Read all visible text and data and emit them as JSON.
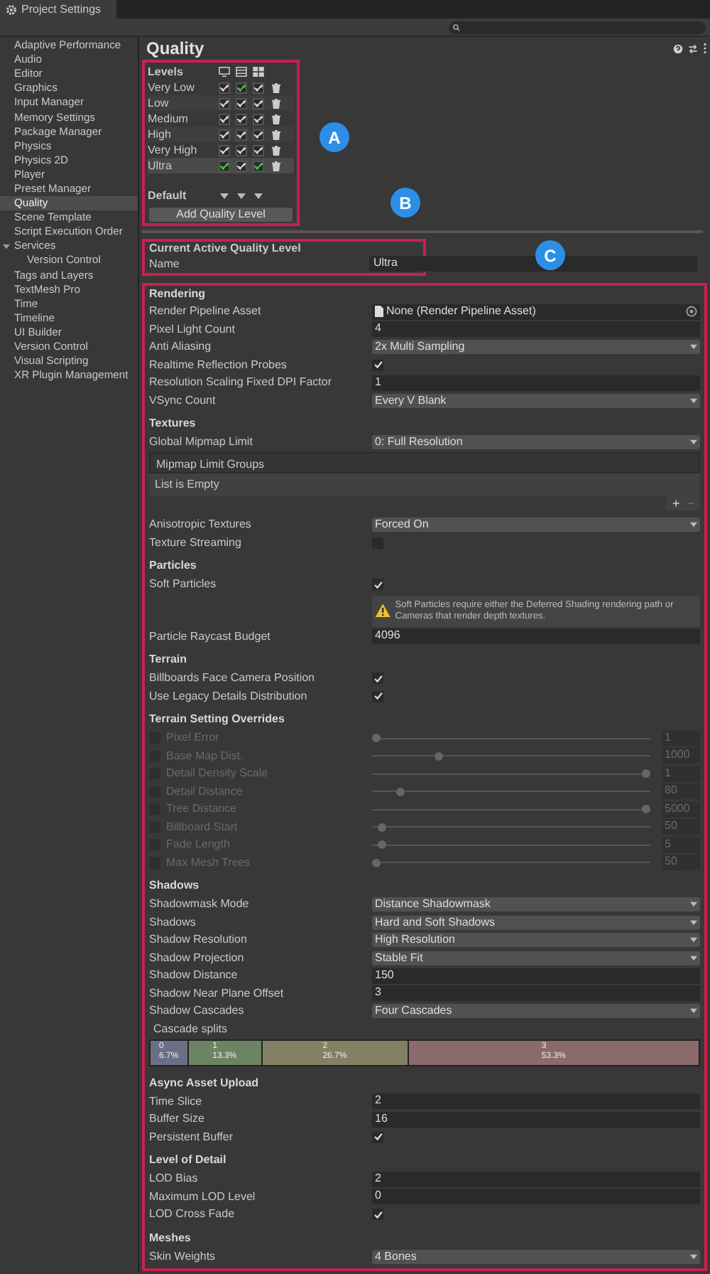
{
  "window": {
    "title": "Project Settings"
  },
  "sidebar": {
    "items": [
      {
        "label": "Adaptive Performance",
        "selected": false
      },
      {
        "label": "Audio",
        "selected": false
      },
      {
        "label": "Editor",
        "selected": false
      },
      {
        "label": "Graphics",
        "selected": false
      },
      {
        "label": "Input Manager",
        "selected": false
      },
      {
        "label": "Memory Settings",
        "selected": false
      },
      {
        "label": "Package Manager",
        "selected": false
      },
      {
        "label": "Physics",
        "selected": false
      },
      {
        "label": "Physics 2D",
        "selected": false
      },
      {
        "label": "Player",
        "selected": false
      },
      {
        "label": "Preset Manager",
        "selected": false
      },
      {
        "label": "Quality",
        "selected": true
      },
      {
        "label": "Scene Template",
        "selected": false
      },
      {
        "label": "Script Execution Order",
        "selected": false
      },
      {
        "label": "Services",
        "selected": false,
        "expanded": true,
        "children": [
          {
            "label": "Version Control",
            "selected": false
          }
        ]
      },
      {
        "label": "Tags and Layers",
        "selected": false
      },
      {
        "label": "TextMesh Pro",
        "selected": false
      },
      {
        "label": "Time",
        "selected": false
      },
      {
        "label": "Timeline",
        "selected": false
      },
      {
        "label": "UI Builder",
        "selected": false
      },
      {
        "label": "Version Control",
        "selected": false
      },
      {
        "label": "Visual Scripting",
        "selected": false
      },
      {
        "label": "XR Plugin Management",
        "selected": false
      }
    ]
  },
  "page_title": "Quality",
  "levels": {
    "title": "Levels",
    "rows": [
      {
        "name": "Very Low",
        "selected": false,
        "platforms": [
          {
            "checked": true,
            "color": "#c8c8c8"
          },
          {
            "checked": true,
            "color": "#3fbf3f"
          },
          {
            "checked": true,
            "color": "#c8c8c8"
          }
        ]
      },
      {
        "name": "Low",
        "selected": false,
        "platforms": [
          {
            "checked": true,
            "color": "#c8c8c8"
          },
          {
            "checked": true,
            "color": "#c8c8c8"
          },
          {
            "checked": true,
            "color": "#c8c8c8"
          }
        ]
      },
      {
        "name": "Medium",
        "selected": false,
        "platforms": [
          {
            "checked": true,
            "color": "#c8c8c8"
          },
          {
            "checked": true,
            "color": "#c8c8c8"
          },
          {
            "checked": true,
            "color": "#c8c8c8"
          }
        ]
      },
      {
        "name": "High",
        "selected": false,
        "platforms": [
          {
            "checked": true,
            "color": "#c8c8c8"
          },
          {
            "checked": true,
            "color": "#c8c8c8"
          },
          {
            "checked": true,
            "color": "#c8c8c8"
          }
        ]
      },
      {
        "name": "Very High",
        "selected": false,
        "platforms": [
          {
            "checked": true,
            "color": "#c8c8c8"
          },
          {
            "checked": true,
            "color": "#c8c8c8"
          },
          {
            "checked": true,
            "color": "#c8c8c8"
          }
        ]
      },
      {
        "name": "Ultra",
        "selected": true,
        "platforms": [
          {
            "checked": true,
            "color": "#3fbf3f"
          },
          {
            "checked": true,
            "color": "#c8c8c8"
          },
          {
            "checked": true,
            "color": "#3fbf3f"
          }
        ]
      }
    ],
    "default_label": "Default",
    "add_button": "Add Quality Level"
  },
  "callouts": [
    {
      "label": "A"
    },
    {
      "label": "B"
    },
    {
      "label": "C"
    }
  ],
  "current_level": {
    "title": "Current Active Quality Level",
    "name_label": "Name",
    "name_value": "Ultra"
  },
  "sections": [
    {
      "title": "Rendering",
      "rows": [
        {
          "kind": "asset",
          "label": "Render Pipeline Asset",
          "value": "None (Render Pipeline Asset)"
        },
        {
          "kind": "number",
          "label": "Pixel Light Count",
          "value": "4"
        },
        {
          "kind": "dropdown",
          "label": "Anti Aliasing",
          "value": "2x Multi Sampling"
        },
        {
          "kind": "toggle",
          "label": "Realtime Reflection Probes",
          "checked": true
        },
        {
          "kind": "number",
          "label": "Resolution Scaling Fixed DPI Factor",
          "value": "1"
        },
        {
          "kind": "dropdown",
          "label": "VSync Count",
          "value": "Every V Blank"
        }
      ]
    },
    {
      "title": "Textures",
      "rows": [
        {
          "kind": "dropdown",
          "label": "Global Mipmap Limit",
          "value": "0: Full Resolution"
        },
        {
          "kind": "list",
          "label": "Mipmap Limit Groups",
          "value": "List is Empty",
          "add": "+",
          "remove": "−"
        },
        {
          "kind": "dropdown",
          "label": "Anisotropic Textures",
          "value": "Forced On"
        },
        {
          "kind": "toggle",
          "label": "Texture Streaming",
          "checked": false
        }
      ]
    },
    {
      "title": "Particles",
      "rows": [
        {
          "kind": "toggle",
          "label": "Soft Particles",
          "checked": true
        },
        {
          "kind": "warning",
          "value": "Soft Particles require either the Deferred Shading rendering path or Cameras that render depth textures."
        },
        {
          "kind": "number",
          "label": "Particle Raycast Budget",
          "value": "4096"
        }
      ]
    },
    {
      "title": "Terrain",
      "rows": [
        {
          "kind": "toggle",
          "label": "Billboards Face Camera Position",
          "checked": true
        },
        {
          "kind": "toggle",
          "label": "Use Legacy Details Distribution",
          "checked": true
        }
      ]
    },
    {
      "title": "Terrain Setting Overrides",
      "rows": [
        {
          "kind": "slider",
          "label": "Pixel Error",
          "override": false,
          "level": 0,
          "value": "1"
        },
        {
          "kind": "slider",
          "label": "Base Map Dist.",
          "override": false,
          "level": 0.23,
          "value": "1000"
        },
        {
          "kind": "slider",
          "label": "Detail Density Scale",
          "override": false,
          "level": 1,
          "value": "1"
        },
        {
          "kind": "slider",
          "label": "Detail Distance",
          "override": false,
          "level": 0.09,
          "value": "80"
        },
        {
          "kind": "slider",
          "label": "Tree Distance",
          "override": false,
          "level": 1,
          "value": "5000"
        },
        {
          "kind": "slider",
          "label": "Billboard Start",
          "override": false,
          "level": 0.02,
          "value": "50"
        },
        {
          "kind": "slider",
          "label": "Fade Length",
          "override": false,
          "level": 0.02,
          "value": "5"
        },
        {
          "kind": "slider",
          "label": "Max Mesh Trees",
          "override": false,
          "level": 0,
          "value": "50"
        }
      ]
    },
    {
      "title": "Shadows",
      "rows": [
        {
          "kind": "dropdown",
          "label": "Shadowmask Mode",
          "value": "Distance Shadowmask"
        },
        {
          "kind": "dropdown",
          "label": "Shadows",
          "value": "Hard and Soft Shadows"
        },
        {
          "kind": "dropdown",
          "label": "Shadow Resolution",
          "value": "High Resolution"
        },
        {
          "kind": "dropdown",
          "label": "Shadow Projection",
          "value": "Stable Fit"
        },
        {
          "kind": "number",
          "label": "Shadow Distance",
          "value": "150"
        },
        {
          "kind": "number",
          "label": "Shadow Near Plane Offset",
          "value": "3"
        },
        {
          "kind": "dropdown",
          "label": "Shadow Cascades",
          "value": "Four Cascades"
        },
        {
          "kind": "cascades",
          "label": "Cascade splits",
          "splits": [
            {
              "index": "0",
              "percent": "6.7%",
              "level": 0.067,
              "color": "#6b6f86"
            },
            {
              "index": "1",
              "percent": "13.3%",
              "level": 0.133,
              "color": "#6b8563"
            },
            {
              "index": "2",
              "percent": "26.7%",
              "level": 0.267,
              "color": "#848064"
            },
            {
              "index": "3",
              "percent": "53.3%",
              "level": 0.533,
              "color": "#8a6a6a"
            }
          ]
        }
      ]
    },
    {
      "title": "Async Asset Upload",
      "rows": [
        {
          "kind": "number",
          "label": "Time Slice",
          "value": "2"
        },
        {
          "kind": "number",
          "label": "Buffer Size",
          "value": "16"
        },
        {
          "kind": "toggle",
          "label": "Persistent Buffer",
          "checked": true
        }
      ]
    },
    {
      "title": "Level of Detail",
      "rows": [
        {
          "kind": "number",
          "label": "LOD Bias",
          "value": "2"
        },
        {
          "kind": "number",
          "label": "Maximum LOD Level",
          "value": "0"
        },
        {
          "kind": "toggle",
          "label": "LOD Cross Fade",
          "checked": true
        }
      ]
    },
    {
      "title": "Meshes",
      "rows": [
        {
          "kind": "dropdown",
          "label": "Skin Weights",
          "value": "4 Bones"
        }
      ]
    }
  ]
}
